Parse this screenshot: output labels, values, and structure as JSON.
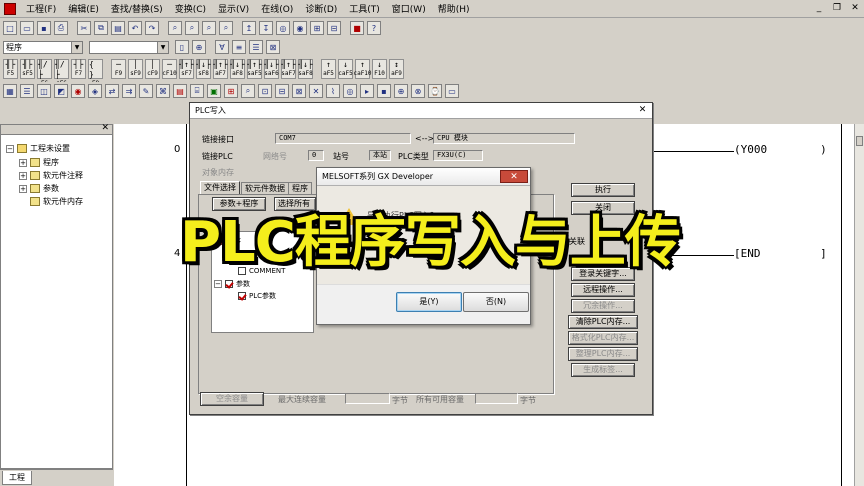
{
  "menu": [
    "工程(F)",
    "编辑(E)",
    "查找/替换(S)",
    "变换(C)",
    "显示(V)",
    "在线(O)",
    "诊断(D)",
    "工具(T)",
    "窗口(W)",
    "帮助(H)"
  ],
  "toolbar": {
    "program_select": "程序",
    "second_select": ""
  },
  "fkeys": [
    {
      "sym": "╢├",
      "label": "F5"
    },
    {
      "sym": "╢├",
      "label": "sF5"
    },
    {
      "sym": "╢/├",
      "label": "F6"
    },
    {
      "sym": "╢/├",
      "label": "sF6"
    },
    {
      "sym": "┤├",
      "label": "F7"
    },
    {
      "sym": "{ }",
      "label": "F8"
    },
    {
      "sym": "─",
      "label": "F9"
    },
    {
      "sym": "│",
      "label": "sF9"
    },
    {
      "sym": "│",
      "label": "cF9"
    },
    {
      "sym": "─",
      "label": "cF10"
    },
    {
      "sym": "╢↑├",
      "label": "sF7"
    },
    {
      "sym": "╢↓├",
      "label": "sF8"
    },
    {
      "sym": "╢↑├",
      "label": "aF7"
    },
    {
      "sym": "╢↓├",
      "label": "aF8"
    },
    {
      "sym": "╢↑├",
      "label": "saF5"
    },
    {
      "sym": "╢↓├",
      "label": "saF6"
    },
    {
      "sym": "╢↑├",
      "label": "saF7"
    },
    {
      "sym": "╢↓├",
      "label": "saF8"
    },
    {
      "sym": "↑",
      "label": "aF5"
    },
    {
      "sym": "↓",
      "label": "caF5"
    },
    {
      "sym": "↑",
      "label": "caF10"
    },
    {
      "sym": "↓",
      "label": "F10"
    },
    {
      "sym": "↕",
      "label": "aF9"
    }
  ],
  "tree": {
    "root": "工程未设置",
    "items": [
      "程序",
      "软元件注释",
      "参数",
      "软元件内存"
    ],
    "tab": "工程"
  },
  "ladder": {
    "steps": [
      "0",
      "4"
    ],
    "coil": "Y000",
    "end": "END"
  },
  "plc_dialog": {
    "title": "PLC写入",
    "link_interface_label": "链接接口",
    "link_interface_value": "COM7",
    "link_arrow": "<-->",
    "cpu_module": "CPU 模块",
    "link_plc_label": "链接PLC",
    "network_no_label": "网络号",
    "network_no_value": "0",
    "station_label": "站号",
    "station_value": "本站",
    "plc_type_label": "PLC类型",
    "plc_type_value": "FX3U(C)",
    "target_memory_label": "对象内存",
    "tabs": [
      "文件选择",
      "软元件数据",
      "程序"
    ],
    "btn_param_program": "参数+程序",
    "btn_select_all": "选择所有",
    "file_tree": [
      "程序",
      "COMMENT",
      "参数",
      "PLC参数"
    ],
    "side_buttons": [
      "执行",
      "关闭",
      "关联",
      "登录关键字...",
      "远程操作...",
      "冗余操作...",
      "清除PLC内存...",
      "格式化PLC内存...",
      "整理PLC内存...",
      "生成标签..."
    ],
    "footer": {
      "free_capacity": "空余容量",
      "max_continuous": "最大连续容量",
      "unit1": "字节",
      "all_free": "所有可用容量",
      "unit2": "字节"
    }
  },
  "msgbox": {
    "title": "MELSOFT系列 GX Developer",
    "message": "是否执行PLC写入？",
    "yes": "是(Y)",
    "no": "否(N)"
  },
  "caption": "PLC程序写入与上传",
  "colors": {
    "caption_fill": "#f4ee1c",
    "caption_outline": "#000000",
    "ui_face": "#d4d0c8",
    "close_red": "#c84a3a"
  }
}
